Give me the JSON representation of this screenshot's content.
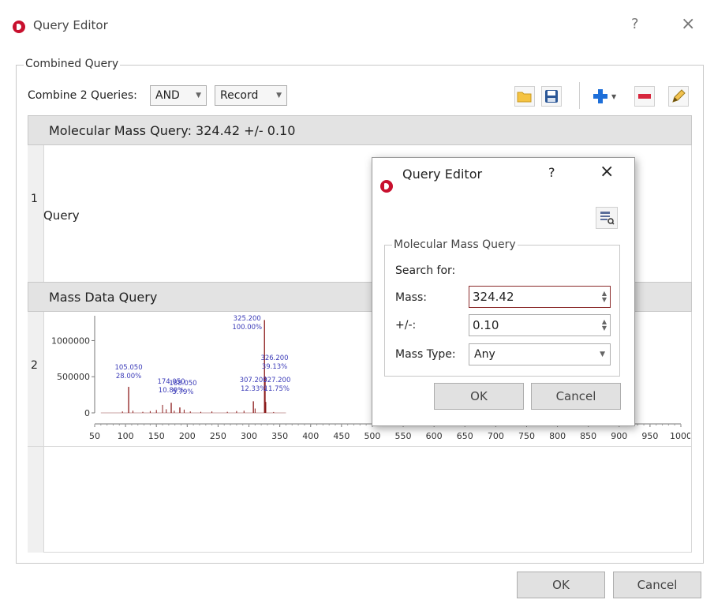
{
  "main_dialog": {
    "title": "Query Editor",
    "help": "?",
    "close": "×",
    "group_title": "Combined Query",
    "combine_label": "Combine 2 Queries:",
    "combine_op": "AND",
    "combine_scope": "Record",
    "toolbar": [
      "folder-icon",
      "save-icon",
      "add-icon",
      "remove-icon",
      "edit-pencil-icon"
    ],
    "rows": [
      {
        "number": "1",
        "header": "Molecular Mass Query: 324.42 +/- 0.10",
        "body_label": "Query"
      },
      {
        "number": "2",
        "header": "Mass Data Query"
      }
    ],
    "ok_label": "OK",
    "cancel_label": "Cancel"
  },
  "chart_data": {
    "type": "bar",
    "xlim": [
      50,
      1000
    ],
    "ylim": [
      0,
      1300000
    ],
    "x_ticks": [
      "50",
      "100",
      "150",
      "200",
      "250",
      "300",
      "350",
      "400",
      "450",
      "500",
      "550",
      "600",
      "650",
      "700",
      "750",
      "800",
      "850",
      "900",
      "950",
      "1000"
    ],
    "y_ticks": [
      "0",
      "500000",
      "1000000"
    ],
    "peaks": [
      {
        "x": 105.05,
        "y": 360000,
        "labels": [
          "105.050",
          "28.00%"
        ]
      },
      {
        "x": 174.05,
        "y": 140000,
        "labels": [
          "174.050",
          "10.89%"
        ]
      },
      {
        "x": 188.05,
        "y": 75000,
        "labels": [
          "188.050",
          "5.79%"
        ]
      },
      {
        "x": 307.2,
        "y": 160000,
        "labels": [
          "307.200",
          "12.33%"
        ]
      },
      {
        "x": 325.2,
        "y": 1285000,
        "labels": [
          "325.200",
          "100.00%"
        ]
      },
      {
        "x": 326.2,
        "y": 503000,
        "labels": [
          "326.200",
          "39.13%"
        ]
      },
      {
        "x": 327.2,
        "y": 151000,
        "labels": [
          "327.200",
          "11.75%"
        ]
      }
    ],
    "minor_peaks": [
      {
        "x": 95,
        "y": 20000
      },
      {
        "x": 112,
        "y": 30000
      },
      {
        "x": 128,
        "y": 15000
      },
      {
        "x": 140,
        "y": 25000
      },
      {
        "x": 150,
        "y": 40000
      },
      {
        "x": 160,
        "y": 110000
      },
      {
        "x": 166,
        "y": 50000
      },
      {
        "x": 179,
        "y": 30000
      },
      {
        "x": 195,
        "y": 45000
      },
      {
        "x": 205,
        "y": 20000
      },
      {
        "x": 222,
        "y": 15000
      },
      {
        "x": 240,
        "y": 20000
      },
      {
        "x": 265,
        "y": 15000
      },
      {
        "x": 280,
        "y": 25000
      },
      {
        "x": 292,
        "y": 30000
      },
      {
        "x": 310,
        "y": 60000
      },
      {
        "x": 340,
        "y": 12000
      }
    ]
  },
  "inner_dialog": {
    "title": "Query Editor",
    "help": "?",
    "close": "×",
    "group_title": "Molecular Mass Query",
    "search_for": "Search for:",
    "mass_label": "Mass:",
    "mass_value": "324.42",
    "tol_label": "+/-:",
    "tol_value": "0.10",
    "type_label": "Mass Type:",
    "type_value": "Any",
    "ok_label": "OK",
    "cancel_label": "Cancel"
  }
}
